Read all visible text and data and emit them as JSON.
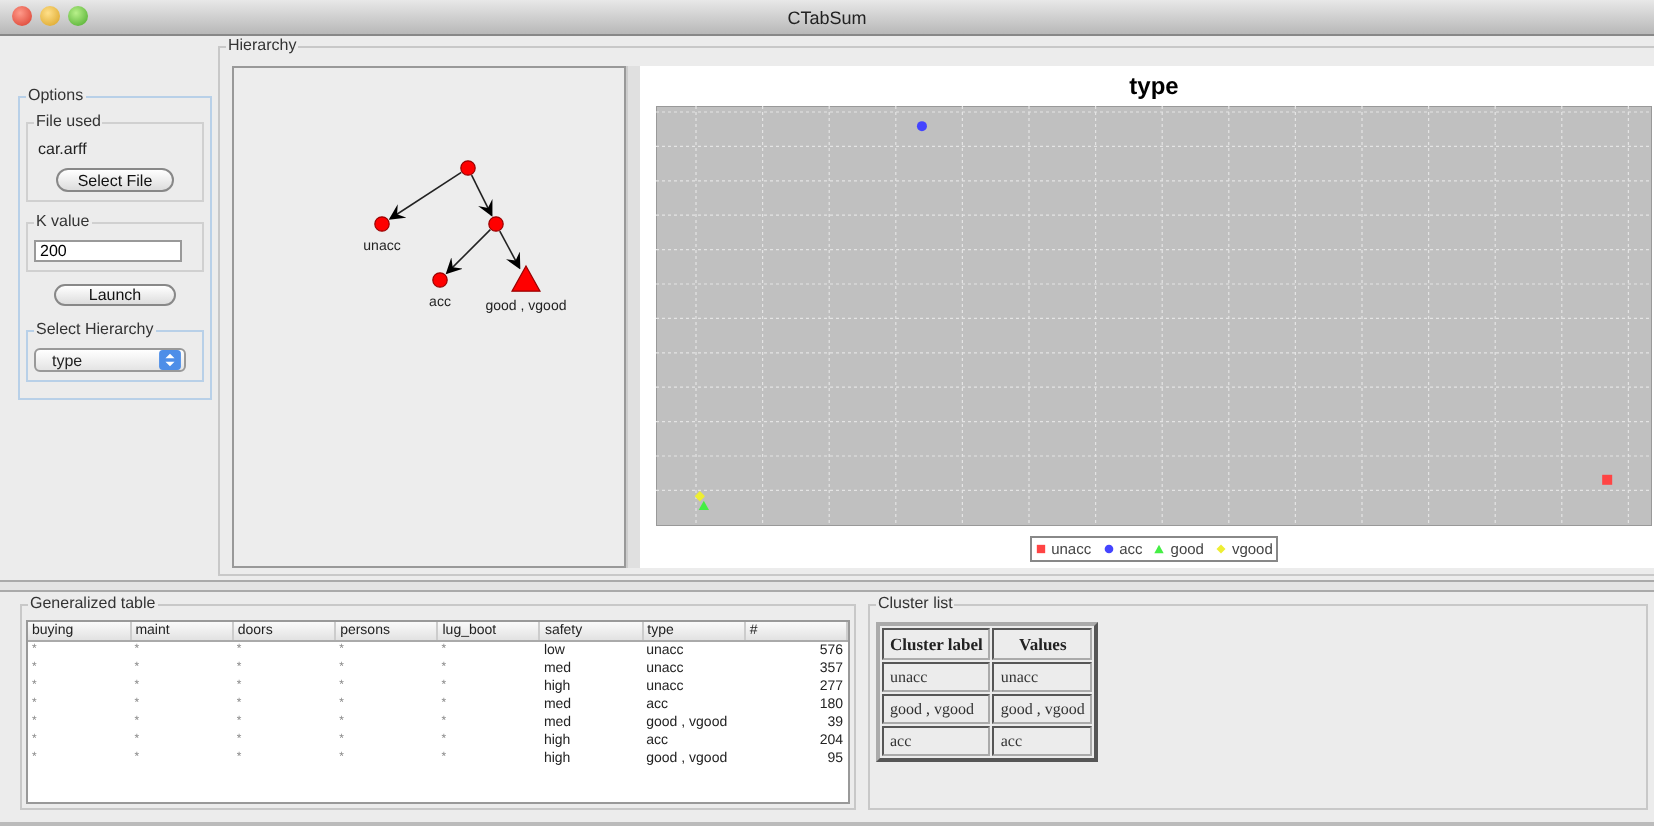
{
  "window": {
    "title": "CTabSum"
  },
  "options": {
    "title": "Options",
    "file_group": {
      "title": "File used",
      "file": "car.arff",
      "button": "Select File"
    },
    "k_group": {
      "title": "K value",
      "value": "200"
    },
    "launch_button": "Launch",
    "hierarchy_group": {
      "title": "Select Hierarchy",
      "selected": "type"
    }
  },
  "hierarchy": {
    "title": "Hierarchy",
    "tree": {
      "kind": "circle",
      "children": [
        {
          "label": "unacc",
          "kind": "circle"
        },
        {
          "kind": "circle",
          "children": [
            {
              "label": "acc",
              "kind": "circle"
            },
            {
              "label": "good , vgood",
              "kind": "triangle"
            }
          ]
        }
      ]
    },
    "plot": {
      "title": "type",
      "legend": [
        {
          "label": "unacc",
          "color": "#ff4444",
          "kind": "square"
        },
        {
          "label": "acc",
          "color": "#4444ff",
          "kind": "circle"
        },
        {
          "label": "good",
          "color": "#44ee44",
          "kind": "triangle"
        },
        {
          "label": "vgood",
          "color": "#eeee33",
          "kind": "diamond"
        }
      ]
    }
  },
  "generalized_table": {
    "title": "Generalized table",
    "columns": [
      "buying",
      "maint",
      "doors",
      "persons",
      "lug_boot",
      "safety",
      "type",
      "#"
    ],
    "rows": [
      [
        "*",
        "*",
        "*",
        "*",
        "*",
        "low",
        "unacc",
        "576"
      ],
      [
        "*",
        "*",
        "*",
        "*",
        "*",
        "med",
        "unacc",
        "357"
      ],
      [
        "*",
        "*",
        "*",
        "*",
        "*",
        "high",
        "unacc",
        "277"
      ],
      [
        "*",
        "*",
        "*",
        "*",
        "*",
        "med",
        "acc",
        "180"
      ],
      [
        "*",
        "*",
        "*",
        "*",
        "*",
        "med",
        "good , vgood",
        "39"
      ],
      [
        "*",
        "*",
        "*",
        "*",
        "*",
        "high",
        "acc",
        "204"
      ],
      [
        "*",
        "*",
        "*",
        "*",
        "*",
        "high",
        "good , vgood",
        "95"
      ]
    ]
  },
  "cluster_list": {
    "title": "Cluster list",
    "columns": [
      "Cluster label",
      "Values"
    ],
    "rows": [
      [
        "unacc",
        "unacc"
      ],
      [
        "good , vgood",
        "good , vgood"
      ],
      [
        "acc",
        "acc"
      ]
    ]
  }
}
